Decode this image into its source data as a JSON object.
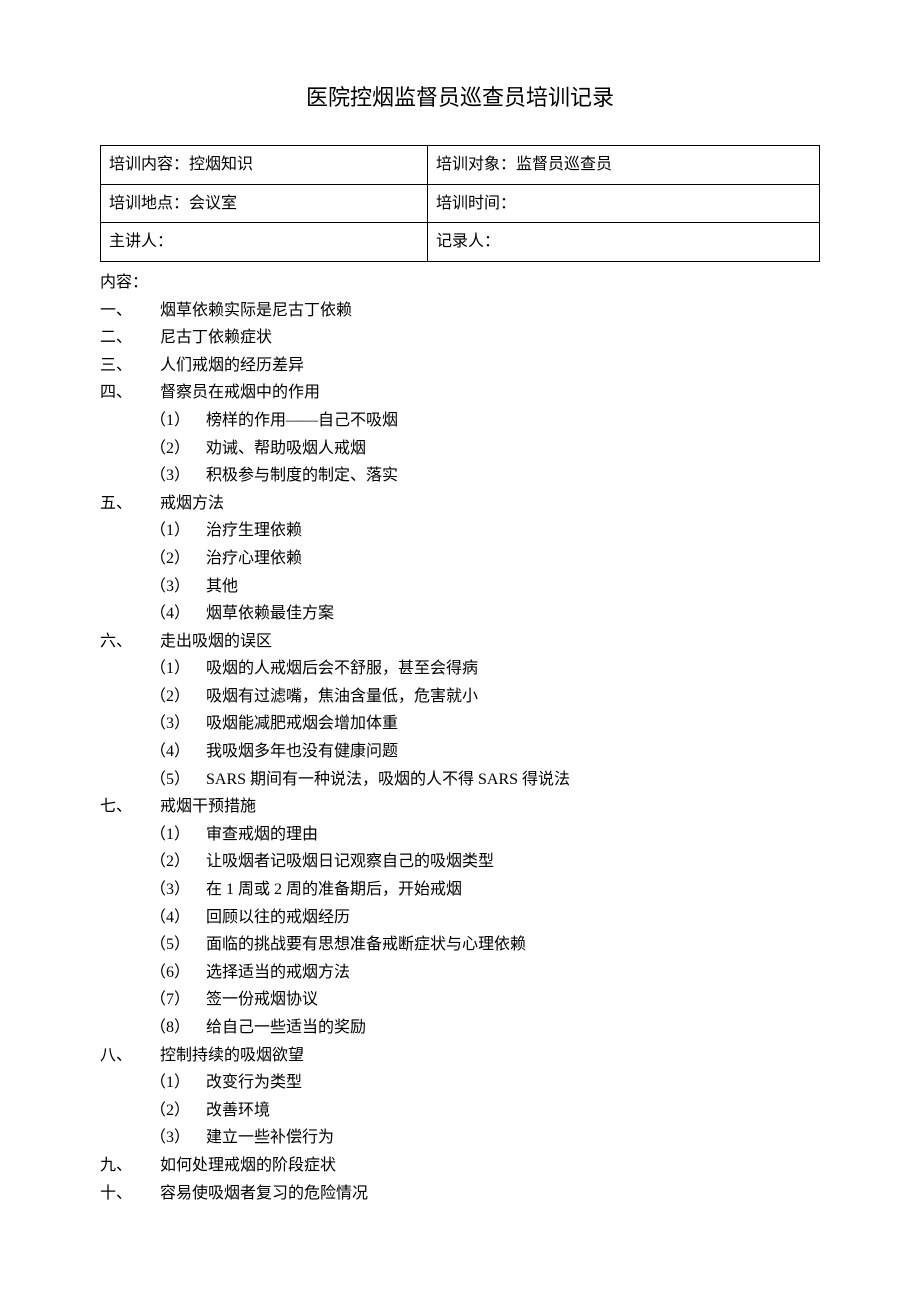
{
  "title": "医院控烟监督员巡查员培训记录",
  "table": {
    "r1c1": "培训内容：控烟知识",
    "r1c2": "培训对象：监督员巡查员",
    "r2c1": "培训地点：会议室",
    "r2c2": "培训时间：",
    "r3c1": "主讲人：",
    "r3c2": "记录人："
  },
  "contentLabel": "内容：",
  "sections": {
    "s1": {
      "num": "一、",
      "title": "烟草依赖实际是尼古丁依赖"
    },
    "s2": {
      "num": "二、",
      "title": "尼古丁依赖症状"
    },
    "s3": {
      "num": "三、",
      "title": "人们戒烟的经历差异"
    },
    "s4": {
      "num": "四、",
      "title": "督察员在戒烟中的作用",
      "items": {
        "i1": {
          "num": "（1）",
          "text": "榜样的作用——自己不吸烟"
        },
        "i2": {
          "num": "（2）",
          "text": "劝诫、帮助吸烟人戒烟"
        },
        "i3": {
          "num": "（3）",
          "text": "积极参与制度的制定、落实"
        }
      }
    },
    "s5": {
      "num": "五、",
      "title": "戒烟方法",
      "items": {
        "i1": {
          "num": "（1）",
          "text": "治疗生理依赖"
        },
        "i2": {
          "num": "（2）",
          "text": "治疗心理依赖"
        },
        "i3": {
          "num": "（3）",
          "text": "其他"
        },
        "i4": {
          "num": "（4）",
          "text": "烟草依赖最佳方案"
        }
      }
    },
    "s6": {
      "num": "六、",
      "title": "走出吸烟的误区",
      "items": {
        "i1": {
          "num": "（1）",
          "text": "吸烟的人戒烟后会不舒服，甚至会得病"
        },
        "i2": {
          "num": "（2）",
          "text": "吸烟有过滤嘴，焦油含量低，危害就小"
        },
        "i3": {
          "num": "（3）",
          "text": "吸烟能减肥戒烟会增加体重"
        },
        "i4": {
          "num": "（4）",
          "text": "我吸烟多年也没有健康问题"
        },
        "i5": {
          "num": "（5）",
          "text": "SARS 期间有一种说法，吸烟的人不得 SARS 得说法"
        }
      }
    },
    "s7": {
      "num": "七、",
      "title": "戒烟干预措施",
      "items": {
        "i1": {
          "num": "（1）",
          "text": "审查戒烟的理由"
        },
        "i2": {
          "num": "（2）",
          "text": "让吸烟者记吸烟日记观察自己的吸烟类型"
        },
        "i3": {
          "num": "（3）",
          "text": "在 1 周或 2 周的准备期后，开始戒烟"
        },
        "i4": {
          "num": "（4）",
          "text": "回顾以往的戒烟经历"
        },
        "i5": {
          "num": "（5）",
          "text": "面临的挑战要有思想准备戒断症状与心理依赖"
        },
        "i6": {
          "num": "（6）",
          "text": "选择适当的戒烟方法"
        },
        "i7": {
          "num": "（7）",
          "text": "签一份戒烟协议"
        },
        "i8": {
          "num": "（8）",
          "text": "给自己一些适当的奖励"
        }
      }
    },
    "s8": {
      "num": "八、",
      "title": "控制持续的吸烟欲望",
      "items": {
        "i1": {
          "num": "（1）",
          "text": "改变行为类型"
        },
        "i2": {
          "num": "（2）",
          "text": "改善环境"
        },
        "i3": {
          "num": "（3）",
          "text": "建立一些补偿行为"
        }
      }
    },
    "s9": {
      "num": "九、",
      "title": "如何处理戒烟的阶段症状"
    },
    "s10": {
      "num": "十、",
      "title": "容易使吸烟者复习的危险情况"
    }
  }
}
